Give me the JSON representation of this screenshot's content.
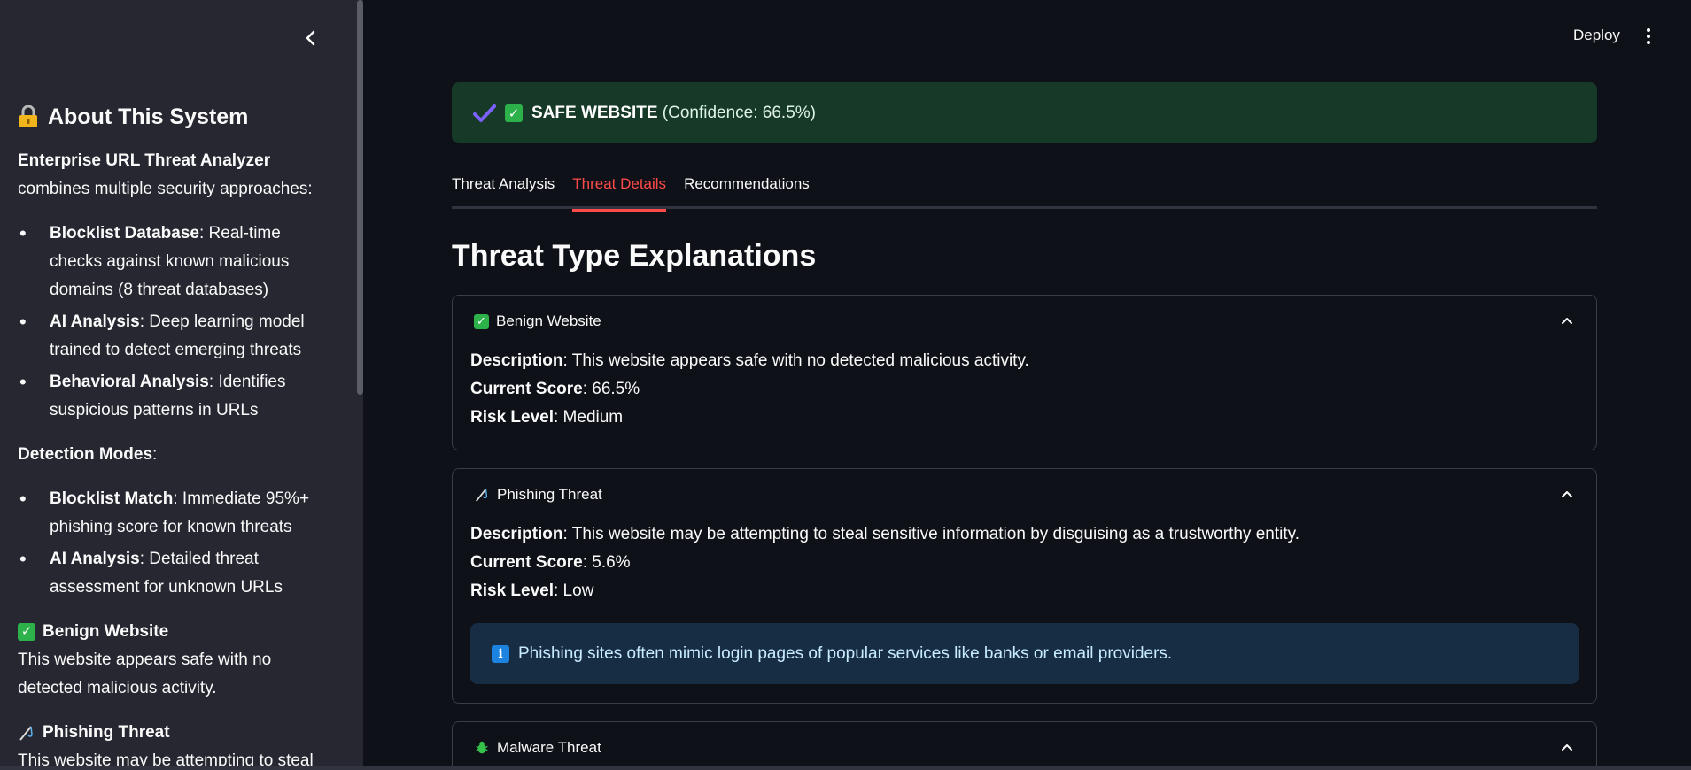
{
  "header": {
    "deploy_label": "Deploy"
  },
  "sidebar": {
    "title": "About This System",
    "intro_bold": "Enterprise URL Threat Analyzer",
    "intro_rest": " combines multiple security approaches:",
    "approaches": [
      {
        "bold": "Blocklist Database",
        "text": ": Real-time checks against known malicious domains (8 threat databases)"
      },
      {
        "bold": "AI Analysis",
        "text": ": Deep learning model trained to detect emerging threats"
      },
      {
        "bold": "Behavioral Analysis",
        "text": ": Identifies suspicious patterns in URLs"
      }
    ],
    "detection_heading": "Detection Modes",
    "detection_colon": ":",
    "modes": [
      {
        "bold": "Blocklist Match",
        "text": ": Immediate 95%+ phishing score for known threats"
      },
      {
        "bold": "AI Analysis",
        "text": ": Detailed threat assessment for unknown URLs"
      }
    ],
    "benign_title": "Benign Website",
    "benign_text": "This website appears safe with no detected malicious activity.",
    "phishing_title": "Phishing Threat",
    "phishing_text": "This website may be attempting to steal"
  },
  "banner": {
    "status": "SAFE WEBSITE",
    "confidence": " (Confidence: 66.5%)"
  },
  "tabs": [
    {
      "label": "Threat Analysis"
    },
    {
      "label": "Threat Details"
    },
    {
      "label": "Recommendations"
    }
  ],
  "active_tab": "Threat Details",
  "section_title": "Threat Type Explanations",
  "labels": {
    "description": "Description",
    "current_score": "Current Score",
    "risk_level": "Risk Level"
  },
  "threats": [
    {
      "title": "Benign Website",
      "description": ": This website appears safe with no detected malicious activity.",
      "score": ": 66.5%",
      "risk": ": Medium"
    },
    {
      "title": "Phishing Threat",
      "description": ": This website may be attempting to steal sensitive information by disguising as a trustworthy entity.",
      "score": ": 5.6%",
      "risk": ": Low",
      "info": "Phishing sites often mimic login pages of popular services like banks or email providers."
    },
    {
      "title": "Malware Threat"
    }
  ],
  "colors": {
    "background": "#0e1117",
    "sidebar": "#262730",
    "success_banner": "#173928",
    "active_tab": "#ff4b4b",
    "info_box": "#172d43"
  }
}
